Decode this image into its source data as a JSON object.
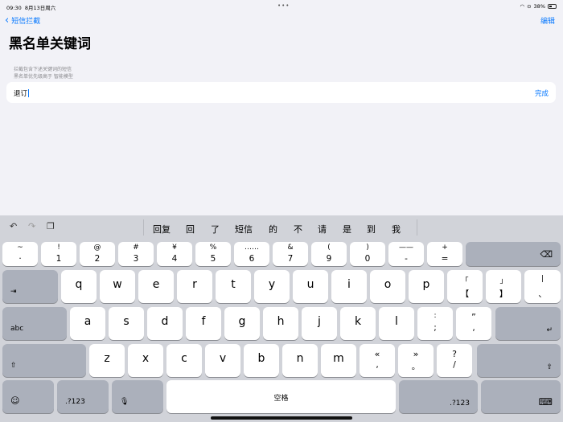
{
  "status": {
    "time": "09:30",
    "date": "8月13日周六",
    "battery": "38%",
    "dots": "•••"
  },
  "nav": {
    "back_label": "短信拦截",
    "edit_label": "编辑"
  },
  "page": {
    "title": "黑名单关键词",
    "desc_line1": "拦截包含下述关键词的短信",
    "desc_line2": "黑名单优先级高于 智能模型"
  },
  "field": {
    "value": "退订",
    "done_label": "完成"
  },
  "toolbar": {
    "undo": "↶",
    "redo": "↷",
    "paste": "❐",
    "candidates": [
      "回复",
      "回",
      "了",
      "短信",
      "的",
      "不",
      "请",
      "是",
      "到",
      "我"
    ]
  },
  "keys": {
    "row1": [
      {
        "t": "~",
        "b": "·"
      },
      {
        "t": "!",
        "b": "1"
      },
      {
        "t": "@",
        "b": "2"
      },
      {
        "t": "#",
        "b": "3"
      },
      {
        "t": "¥",
        "b": "4"
      },
      {
        "t": "%",
        "b": "5"
      },
      {
        "t": "……",
        "b": "6"
      },
      {
        "t": "&",
        "b": "7"
      },
      {
        "t": "(",
        "b": "9"
      },
      {
        "t": ")",
        "b": "0"
      },
      {
        "t": "——",
        "b": "-"
      },
      {
        "t": "+",
        "b": "="
      }
    ],
    "row2": [
      "q",
      "w",
      "e",
      "r",
      "t",
      "y",
      "u",
      "i",
      "o",
      "p"
    ],
    "row2_extra": [
      {
        "t": "「",
        "b": "【"
      },
      {
        "t": "」",
        "b": "】"
      },
      {
        "t": "|",
        "b": "、"
      }
    ],
    "row3": [
      "a",
      "s",
      "d",
      "f",
      "g",
      "h",
      "j",
      "k",
      "l"
    ],
    "row3_extra": [
      {
        "t": ":",
        "b": ";"
      },
      {
        "t": "”",
        "b": ","
      }
    ],
    "row4": [
      "z",
      "x",
      "c",
      "v",
      "b",
      "n",
      "m"
    ],
    "row4_extra": [
      {
        "t": "«",
        "b": ","
      },
      {
        "t": "»",
        "b": "。"
      },
      {
        "t": "?",
        "b": "/"
      }
    ],
    "tab": "⇥",
    "abc": "abc",
    "shift": "⇧",
    "delete": "⌫",
    "return": "↵",
    "emoji": "☺",
    "num": ".?123",
    "mic": "🎙",
    "space": "空格",
    "kbd": "⌨"
  },
  "colors": {
    "accent": "#0a7aff",
    "background": "#f2f2f7",
    "keyboard": "#d1d3d9"
  }
}
